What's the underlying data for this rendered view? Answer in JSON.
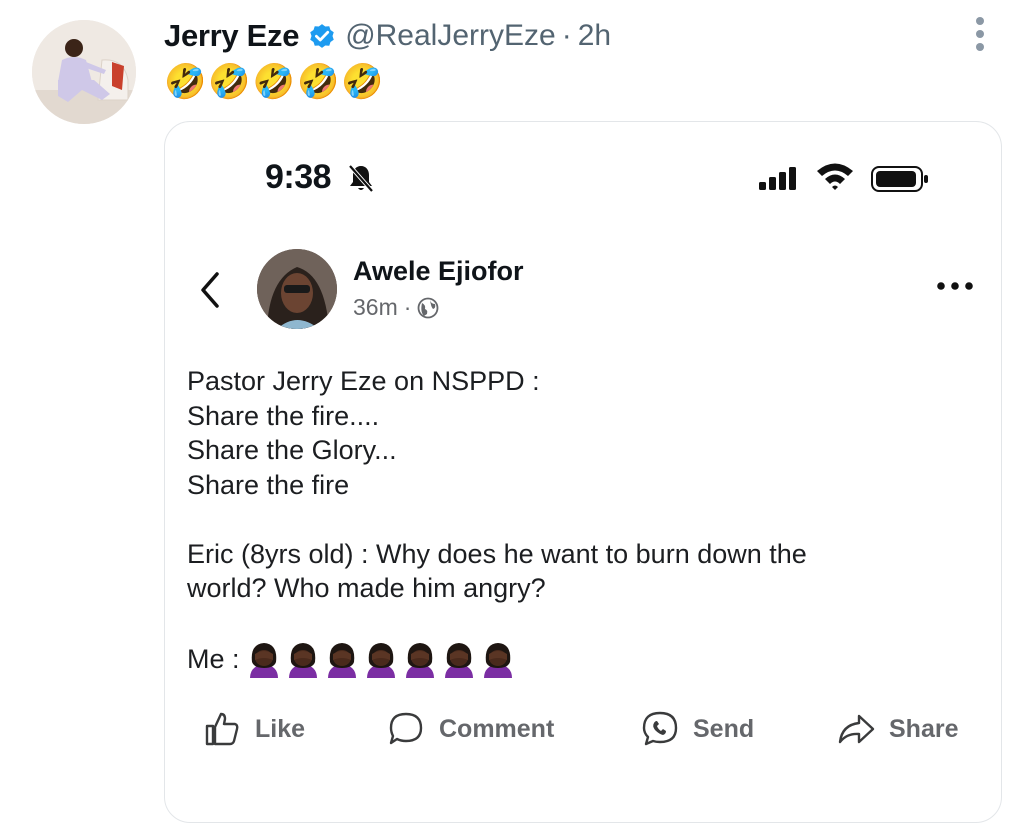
{
  "author": {
    "name": "Jerry Eze",
    "handle": "@RealJerryEze",
    "separator": "·",
    "time": "2h",
    "avatar_icon": "profile-photo",
    "verified_color": "#1d9bf0"
  },
  "tweet": {
    "text": "🤣🤣🤣🤣🤣"
  },
  "screenshot": {
    "status_bar": {
      "time": "9:38",
      "icons": [
        "bell-slash-icon",
        "signal-icon",
        "wifi-icon",
        "battery-icon"
      ]
    },
    "post": {
      "author": "Awele Ejiofor",
      "time": "36m",
      "separator": "·",
      "lines": [
        "Pastor Jerry Eze on NSPPD :",
        "Share the fire....",
        "Share the Glory...",
        "Share the fire",
        "",
        "Eric (8yrs old) : Why  does he want to burn down the",
        "world? Who made him angry?",
        ""
      ],
      "me_label": "Me :",
      "facepalm_count": 7
    },
    "actions": {
      "like": "Like",
      "comment": "Comment",
      "send": "Send",
      "share": "Share"
    }
  }
}
